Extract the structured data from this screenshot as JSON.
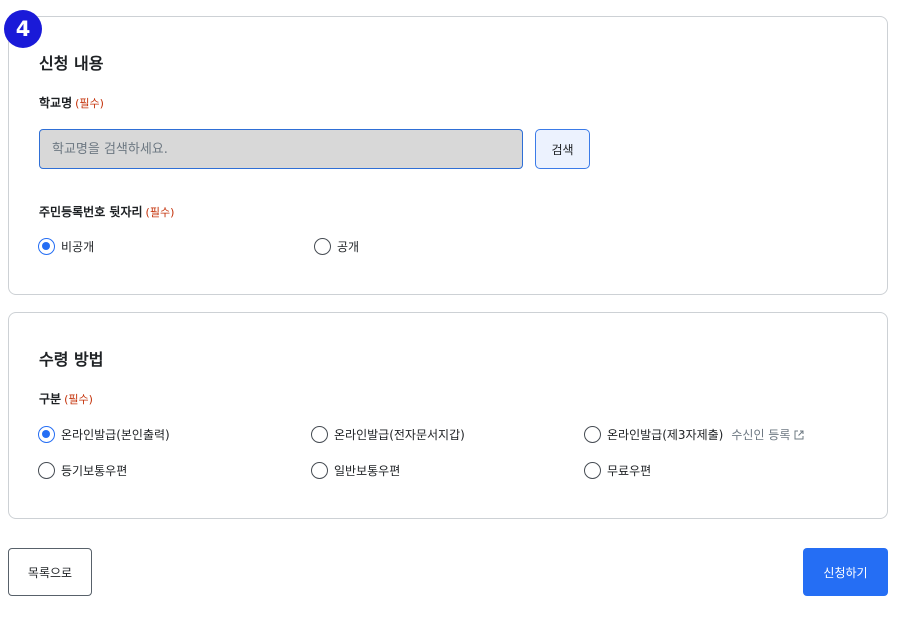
{
  "step_badge": "4",
  "section_application": {
    "title": "신청 내용",
    "school": {
      "label": "학교명",
      "required": "(필수)",
      "placeholder": "학교명을 검색하세요.",
      "search_button": "검색"
    },
    "resident_number": {
      "label": "주민등록번호 뒷자리",
      "required": "(필수)",
      "options": [
        "비공개",
        "공개"
      ],
      "selected": "비공개"
    }
  },
  "section_receipt": {
    "title": "수령 방법",
    "category": {
      "label": "구분",
      "required": "(필수)",
      "options": [
        "온라인발급(본인출력)",
        "온라인발급(전자문서지갑)",
        "온라인발급(제3자제출)",
        "등기보통우편",
        "일반보통우편",
        "무료우편"
      ],
      "third_party_link": "수신인 등록",
      "selected": "온라인발급(본인출력)"
    }
  },
  "actions": {
    "list_button": "목록으로",
    "apply_button": "신청하기"
  },
  "colors": {
    "primary": "#256ef4",
    "badge": "#1a1ad8",
    "required": "#c4320a"
  }
}
